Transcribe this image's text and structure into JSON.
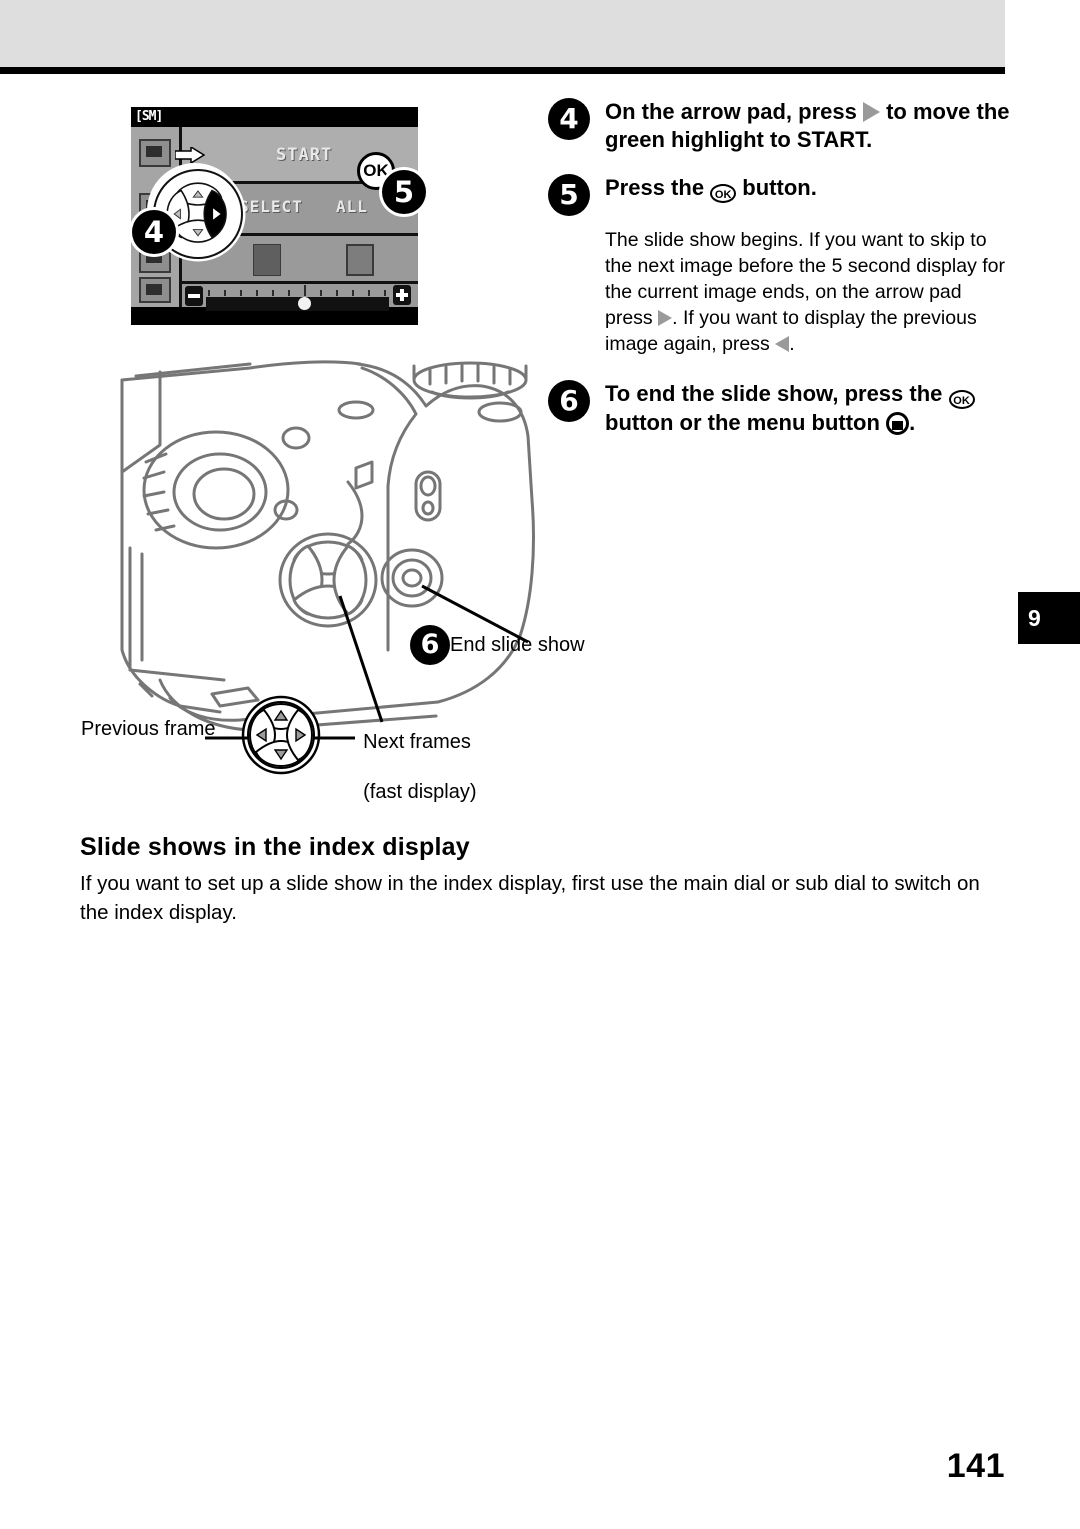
{
  "page": {
    "number": "141",
    "chapter_tab": "9"
  },
  "lcd": {
    "title": "[SM]",
    "rows": [
      {
        "label": "START"
      },
      {
        "label_left": "SELECT",
        "label_right": "ALL"
      },
      {
        "label": ""
      },
      {
        "label": ""
      }
    ],
    "start_text": "START",
    "select_text": "SELECT",
    "all_text": "ALL",
    "minus_icon": "minus-icon",
    "plus_icon": "plus-icon"
  },
  "callouts": {
    "badge_4": "4",
    "badge_5": "5",
    "badge_ok": "OK",
    "badge_6": "6",
    "end_slide_show": "End slide show",
    "previous_frame": "Previous frame",
    "next_frames_line1": "Next frames",
    "next_frames_line2": "(fast display)"
  },
  "instructions": {
    "step4": {
      "number": "4",
      "text_a": "On the arrow pad, press ",
      "icon_a": "triangle-right-icon",
      "text_b": " to move the green highlight to START."
    },
    "step5": {
      "number": "5",
      "text_a": "Press the ",
      "icon_a": "ok-button-icon",
      "icon_a_label": "OK",
      "text_b": " button."
    },
    "step5_note": {
      "text_a": "The slide show begins. If you want to skip to the next image before the 5 second display for the current image ends, on the arrow pad press ",
      "icon_a": "triangle-right-icon",
      "text_b": ". If you want to display the previous image again, press ",
      "icon_b": "triangle-left-icon",
      "text_c": "."
    },
    "step6": {
      "number": "6",
      "text_a": "To end the slide show, press the ",
      "icon_a": "ok-button-icon",
      "icon_a_label": "OK",
      "text_b": " button or the menu button ",
      "icon_b": "menu-button-icon",
      "text_c": "."
    }
  },
  "section": {
    "heading": "Slide shows in the index display",
    "body": "If you want to set up a slide show in the index display, first use the main dial or sub dial to switch on the index display."
  },
  "colors": {
    "header_band": "#dedede",
    "rule": "#000000",
    "lcd_bg": "#9a9a9a",
    "lcd_frame": "#000000",
    "camera_line": "#6e6e6e",
    "tab_bg": "#000000"
  }
}
